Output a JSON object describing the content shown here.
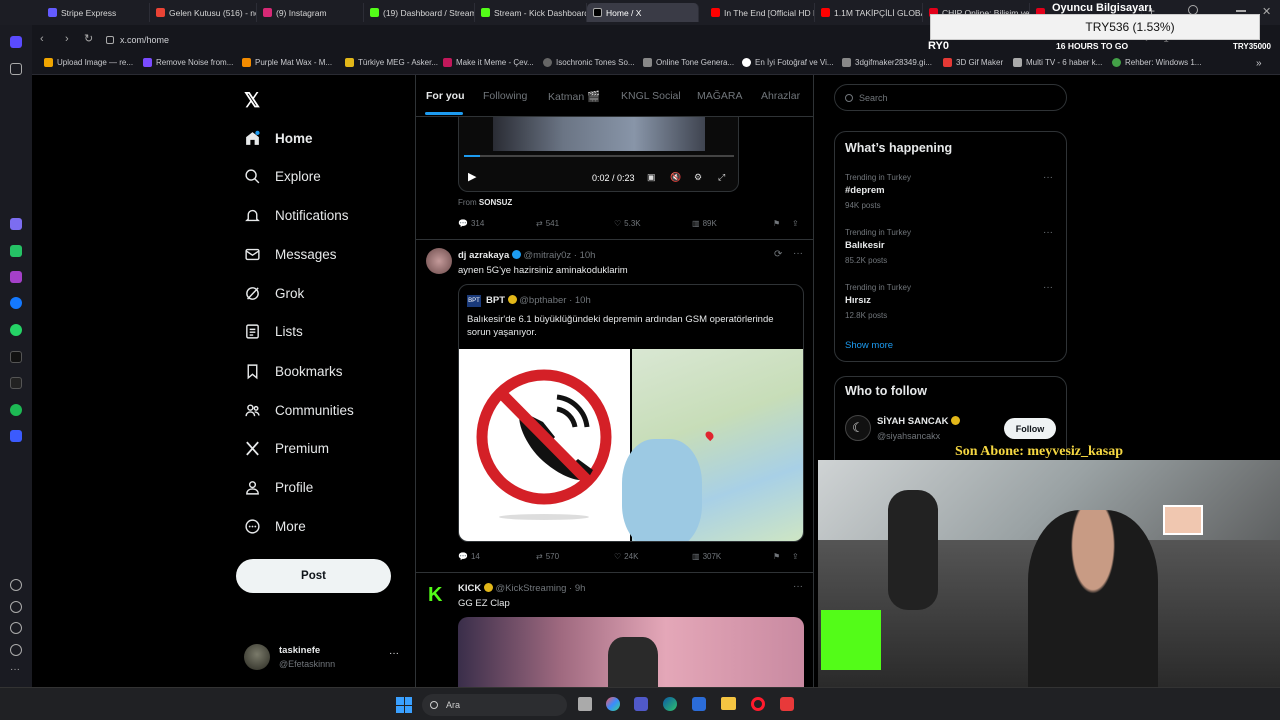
{
  "browser": {
    "tabs": [
      "Stripe Express",
      "Gelen Kutusu (516) - nor",
      "(9) Instagram",
      "(19) Dashboard / Stream",
      "Stream - Kick Dashboard",
      "Home / X",
      "In The End [Official HD M",
      "1.1M TAKİPÇİLİ GLOBAL",
      "CHIP Online: Bilişim ve T",
      ""
    ],
    "url": "x.com/home",
    "bookmarks": [
      "Upload Image — re...",
      "Remove Noise from...",
      "Purple Mat Wax - M...",
      "Türkiye MEG - Asker...",
      "Make it Meme - Çev...",
      "Isochronic Tones So...",
      "Online Tone Genera...",
      "En İyi Fotoğraf ve Vi...",
      "3dgifmaker28349.gi...",
      "3D Gif Maker",
      "Multi TV - 6 haber k...",
      "Rehber: Windows 1..."
    ]
  },
  "overlay": {
    "price": "TRY536 (1.53%)",
    "ticker_left": "RY0",
    "goal": "16 HOURS TO GO",
    "ticker_right": "TRY35000",
    "top_title": "Oyuncu Bilgisayarı",
    "subscriber": "Son Abone: meyvesiz_kasap"
  },
  "nav": {
    "items": [
      "Home",
      "Explore",
      "Notifications",
      "Messages",
      "Grok",
      "Lists",
      "Bookmarks",
      "Communities",
      "Premium",
      "Profile",
      "More"
    ],
    "post": "Post",
    "user_name": "taskinefe",
    "user_handle": "@Efetaskinnn"
  },
  "feed": {
    "tabs": [
      "For you",
      "Following",
      "Katman 🎬",
      "KNGL Social",
      "MAĞARA",
      "Ahrazlar"
    ],
    "video": {
      "time": "0:02 / 0:23",
      "from_label": "From",
      "from_name": "SONSUZ",
      "replies": "314",
      "reposts": "541",
      "likes": "5.3K",
      "views": "89K"
    },
    "post1": {
      "name": "dj azrakaya",
      "handle": "@mitraiy0z · 10h",
      "text": "aynen 5G'ye hazirsiniz aminakoduklarim",
      "quote": {
        "name": "BPT",
        "handle": "@bpthaber · 10h",
        "text": "Balıkesir'de 6.1 büyüklüğündeki depremin ardından GSM operatörlerinde sorun yaşanıyor."
      },
      "replies": "14",
      "reposts": "570",
      "likes": "24K",
      "views": "307K"
    },
    "post2": {
      "name": "KICK",
      "handle": "@KickStreaming · 9h",
      "text": "GG EZ Clap"
    }
  },
  "right": {
    "search_placeholder": "Search",
    "happening_title": "What’s happening",
    "trends": [
      {
        "context": "Trending in Turkey",
        "name": "#deprem",
        "count": "94K posts"
      },
      {
        "context": "Trending in Turkey",
        "name": "Balıkesir",
        "count": "85.2K posts"
      },
      {
        "context": "Trending in Turkey",
        "name": "Hırsız",
        "count": "12.8K posts"
      }
    ],
    "show_more": "Show more",
    "who_title": "Who to follow",
    "follow": {
      "name": "SİYAH SANCAK",
      "handle": "@siyahsancakx",
      "button": "Follow"
    }
  },
  "taskbar": {
    "search": "Ara"
  },
  "colors": {
    "accent": "#1d9bf0",
    "bg": "#000000",
    "border": "#2f3336",
    "muted": "#71767b",
    "verified": "#1d9bf0",
    "gold": "#e2b719"
  }
}
